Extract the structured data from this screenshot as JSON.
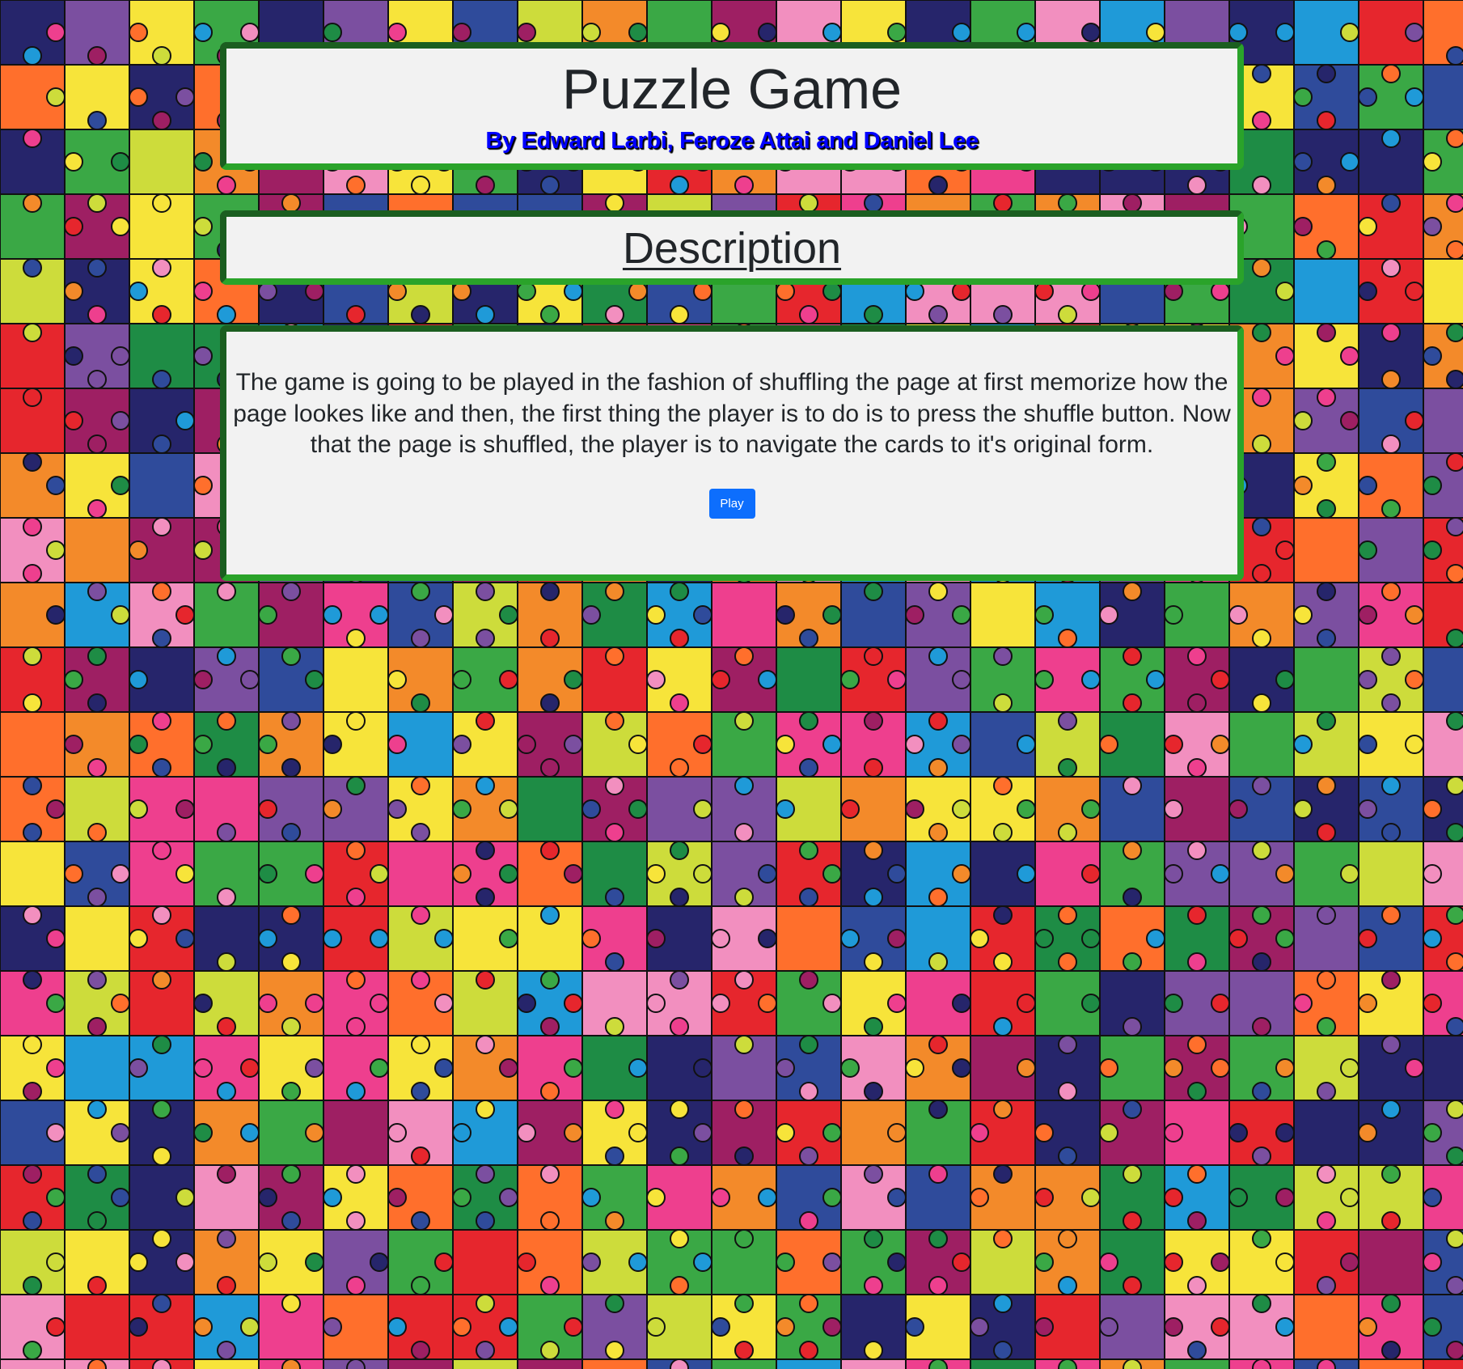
{
  "page": {
    "title": "Puzzle Game",
    "subtitle": "By Edward Larbi, Feroze Attai and Daniel Lee"
  },
  "description": {
    "heading": "Description",
    "text": "The game is going to be played in the fashion of shuffling the page at first memorize how the page lookes like and then, the first thing the player is to do is to press the shuffle button. Now that the page is shuffled, the player is to navigate the cards to it's original form.",
    "play_label": "Play"
  },
  "background": {
    "icon": "jigsaw-puzzle-pattern",
    "palette": [
      "#e6262d",
      "#f7e43a",
      "#1f9ad8",
      "#3aa845",
      "#ee3f8e",
      "#f38a2a",
      "#26256b",
      "#7b4fa0",
      "#cddc3b",
      "#f28fbf",
      "#9e1f63",
      "#1e8c45",
      "#2f4b9b",
      "#ff6f2c"
    ]
  },
  "colors": {
    "card_bg": "#f2f2f2",
    "card_border": "#2aa32a",
    "subtitle": "#0000ff",
    "button": "#0d6efd"
  }
}
